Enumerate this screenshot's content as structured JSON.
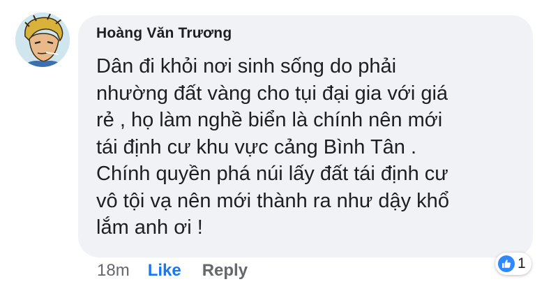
{
  "comment": {
    "author": "Hoàng Văn Trương",
    "lines": [
      "Dân đi khỏi nơi sinh sống do phải",
      "nhường đất vàng cho tụi đại gia với giá",
      "rẻ , họ làm nghề biển là chính nên mới",
      "tái định cư khu vực cảng Bình Tân .",
      "Chính quyền phá núi lấy đất tái định cư",
      "vô tội vạ nên mới thành ra như dậy khổ",
      "lắm anh ơi !"
    ]
  },
  "actions": {
    "time": "18m",
    "like_label": "Like",
    "reply_label": "Reply"
  },
  "reactions": {
    "icon": "thumbs-up-icon",
    "count": "1"
  },
  "colors": {
    "bubble": "#f0f2f5",
    "like_blue": "#1877f2",
    "meta_gray": "#65676b"
  }
}
